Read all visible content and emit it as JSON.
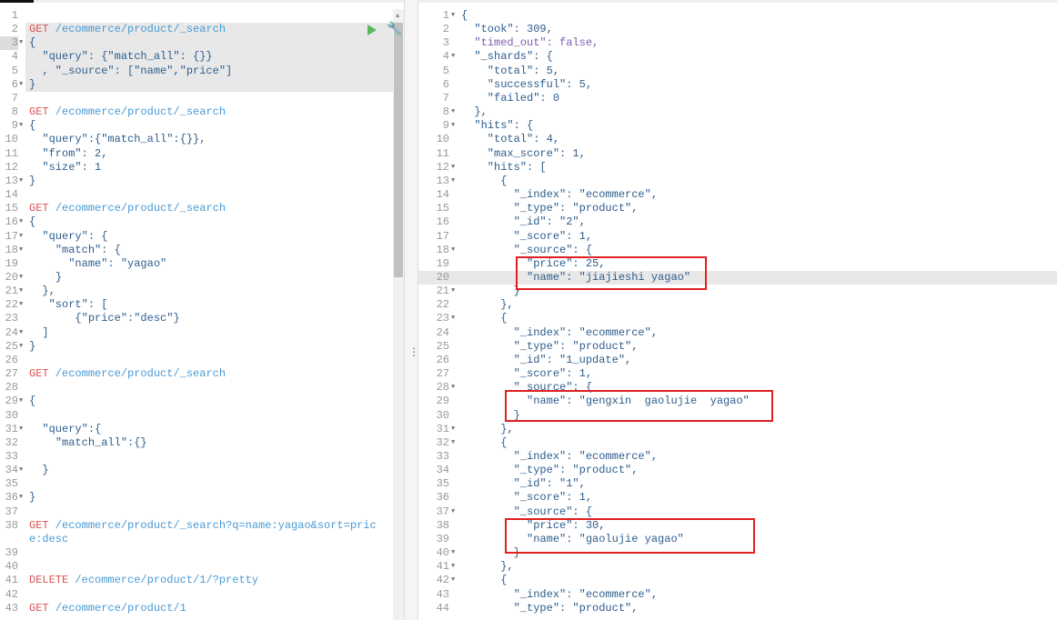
{
  "request_editor": {
    "lines": [
      "",
      "GET /ecommerce/product/_search",
      "{",
      "  \"query\": {\"match_all\": {}}",
      "  , \"_source\": [\"name\",\"price\"]",
      "}",
      "",
      "GET /ecommerce/product/_search",
      "{",
      "  \"query\":{\"match_all\":{}},",
      "  \"from\": 2,",
      "  \"size\": 1",
      "}",
      "",
      "GET /ecommerce/product/_search",
      "{",
      "  \"query\": {",
      "    \"match\": {",
      "      \"name\": \"yagao\"",
      "    }",
      "  },",
      "   \"sort\": [",
      "       {\"price\":\"desc\"}",
      "  ]",
      "}",
      "",
      "GET /ecommerce/product/_search",
      "",
      "{",
      "",
      "  \"query\":{",
      "    \"match_all\":{}",
      "",
      "  }",
      "",
      "}",
      "",
      "GET /ecommerce/product/_search?q=name:yagao&sort=price:desc",
      "",
      "",
      "DELETE /ecommerce/product/1/?pretty",
      "",
      "GET /ecommerce/product/1"
    ],
    "fold_lines": [
      3,
      6,
      9,
      13,
      16,
      17,
      18,
      20,
      21,
      22,
      24,
      25,
      29,
      31,
      34,
      36
    ],
    "active_block": [
      2,
      6
    ],
    "send_button": "play-icon",
    "settings_button": "wrench-icon"
  },
  "response_viewer": {
    "lines": [
      "{",
      "  \"took\": 309,",
      "  \"timed_out\": false,",
      "  \"_shards\": {",
      "    \"total\": 5,",
      "    \"successful\": 5,",
      "    \"failed\": 0",
      "  },",
      "  \"hits\": {",
      "    \"total\": 4,",
      "    \"max_score\": 1,",
      "    \"hits\": [",
      "      {",
      "        \"_index\": \"ecommerce\",",
      "        \"_type\": \"product\",",
      "        \"_id\": \"2\",",
      "        \"_score\": 1,",
      "        \"_source\": {",
      "          \"price\": 25,",
      "          \"name\": \"jiajieshi yagao\"",
      "        }",
      "      },",
      "      {",
      "        \"_index\": \"ecommerce\",",
      "        \"_type\": \"product\",",
      "        \"_id\": \"1_update\",",
      "        \"_score\": 1,",
      "        \"_source\": {",
      "          \"name\": \"gengxin  gaolujie  yagao\"",
      "        }",
      "      },",
      "      {",
      "        \"_index\": \"ecommerce\",",
      "        \"_type\": \"product\",",
      "        \"_id\": \"1\",",
      "        \"_score\": 1,",
      "        \"_source\": {",
      "          \"price\": 30,",
      "          \"name\": \"gaolujie yagao\"",
      "        }",
      "      },",
      "      {",
      "        \"_index\": \"ecommerce\",",
      "        \"_type\": \"product\","
    ],
    "fold_lines": [
      1,
      4,
      8,
      9,
      12,
      13,
      18,
      21,
      23,
      28,
      31,
      32,
      37,
      40,
      41,
      42
    ],
    "highlighted_line": 20
  },
  "colors": {
    "method": "#d9534f",
    "url": "#4a9ad4",
    "string": "#2d5d8c",
    "number": "#1b2fa6",
    "annotation": "#e02020"
  }
}
